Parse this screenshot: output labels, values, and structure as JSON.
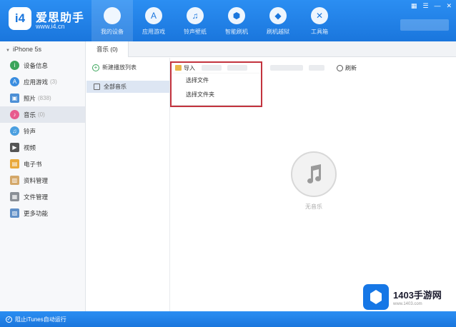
{
  "app": {
    "brand": "爱思助手",
    "url": "www.i4.cn",
    "logo_text": "i4"
  },
  "nav": [
    {
      "label": "我的设备",
      "icon": "apple-icon",
      "glyph": ""
    },
    {
      "label": "应用游戏",
      "icon": "appstore-icon",
      "glyph": "A"
    },
    {
      "label": "铃声壁纸",
      "icon": "bell-icon",
      "glyph": "♫"
    },
    {
      "label": "智能刷机",
      "icon": "flash-icon",
      "glyph": "⬢"
    },
    {
      "label": "刷机越狱",
      "icon": "box-icon",
      "glyph": "◆"
    },
    {
      "label": "工具箱",
      "icon": "tools-icon",
      "glyph": "✕"
    }
  ],
  "window_controls": [
    "▦",
    "☰",
    "—",
    "✕"
  ],
  "sidebar": {
    "device": "iPhone 5s",
    "items": [
      {
        "label": "设备信息",
        "count": "",
        "color": "#3aa55a",
        "glyph": "i"
      },
      {
        "label": "应用游戏",
        "count": "(3)",
        "color": "#3a8de0",
        "glyph": "A"
      },
      {
        "label": "照片",
        "count": "(838)",
        "color": "#4c8fd6",
        "glyph": "▣"
      },
      {
        "label": "音乐",
        "count": "(0)",
        "color": "#e75a8d",
        "glyph": "♪"
      },
      {
        "label": "铃声",
        "count": "",
        "color": "#4a9fe0",
        "glyph": "♫"
      },
      {
        "label": "视频",
        "count": "",
        "color": "#555555",
        "glyph": "▶"
      },
      {
        "label": "电子书",
        "count": "",
        "color": "#e9a93a",
        "glyph": "▤"
      },
      {
        "label": "资料管理",
        "count": "",
        "color": "#d4a86a",
        "glyph": "▥"
      },
      {
        "label": "文件管理",
        "count": "",
        "color": "#8a8f96",
        "glyph": "▦"
      },
      {
        "label": "更多功能",
        "count": "",
        "color": "#5f8fc7",
        "glyph": "▧"
      }
    ]
  },
  "tabs": [
    {
      "label": "音乐 (0)"
    }
  ],
  "playlist": {
    "new_label": "新建播放列表",
    "all_label": "全部音乐"
  },
  "toolbar": {
    "import_label": "导入",
    "refresh_label": "刷新"
  },
  "dropdown": {
    "items": [
      "选择文件",
      "选择文件夹"
    ]
  },
  "empty_state": {
    "text": "无音乐"
  },
  "status": {
    "text": "阻止iTunes自动运行"
  },
  "watermark": {
    "title": "1403手游网",
    "url": "www.1403.com"
  },
  "colors": {
    "brand_blue": "#1a76dd",
    "highlight_red": "#c3333e"
  }
}
